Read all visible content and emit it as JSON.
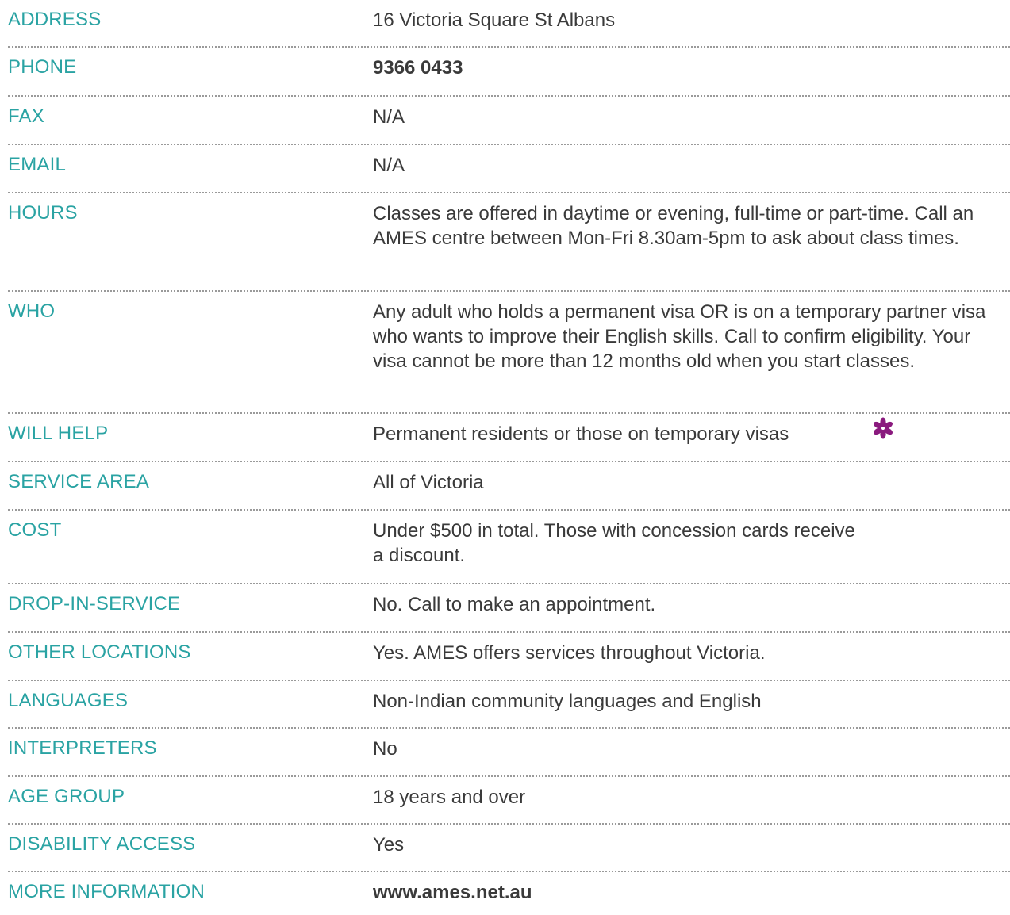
{
  "accent_color": "#2aa3a3",
  "icon_color": "#8a1a7e",
  "rows": [
    {
      "label": "ADDRESS",
      "value": "16 Victoria Square St Albans"
    },
    {
      "label": "PHONE",
      "value": "9366 0433"
    },
    {
      "label": "FAX",
      "value": "N/A"
    },
    {
      "label": "EMAIL",
      "value": "N/A"
    },
    {
      "label": "HOURS",
      "value": "Classes are offered in daytime or evening, full-time or part-time. Call an AMES centre between Mon-Fri 8.30am-5pm to ask about class times."
    },
    {
      "label": "WHO",
      "value": "Any adult who holds a permanent visa OR is on a temporary partner visa who wants to improve their English skills. Call to confirm eligibility. Your visa cannot be more than 12 months old when you start classes."
    },
    {
      "label": "WILL HELP",
      "value": "Permanent residents or those on temporary visas",
      "icon": "flower-icon"
    },
    {
      "label": "SERVICE AREA",
      "value": "All of Victoria"
    },
    {
      "label": "COST",
      "value": "Under $500 in total. Those with concession cards receive a discount."
    },
    {
      "label": "DROP-IN-SERVICE",
      "value": "No. Call to make an appointment."
    },
    {
      "label": "OTHER LOCATIONS",
      "value": "Yes. AMES offers services throughout Victoria."
    },
    {
      "label": "LANGUAGES",
      "value": "Non-Indian community languages and English"
    },
    {
      "label": "INTERPRETERS",
      "value": "No"
    },
    {
      "label": "AGE GROUP",
      "value": "18 years and over"
    },
    {
      "label": "DISABILITY ACCESS",
      "value": "Yes"
    },
    {
      "label": "MORE INFORMATION",
      "value": "www.ames.net.au"
    }
  ]
}
